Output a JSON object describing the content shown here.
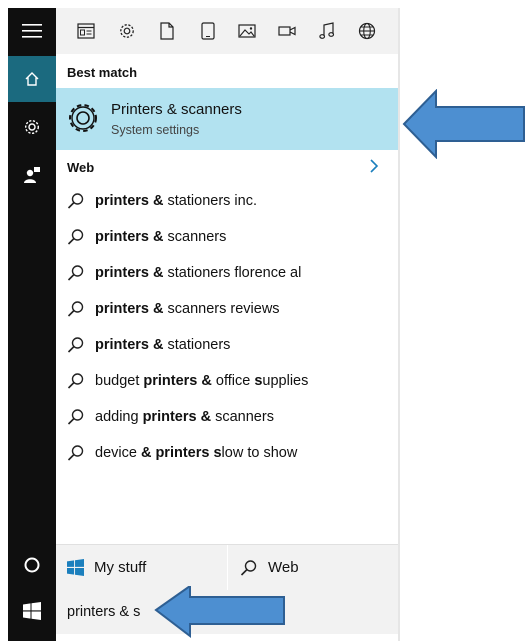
{
  "filters": [
    "apps",
    "settings",
    "documents",
    "tablet",
    "photos",
    "videos",
    "music",
    "web"
  ],
  "best_match": {
    "label": "Best match",
    "title": "Printers & scanners",
    "subtitle": "System settings"
  },
  "web": {
    "label": "Web",
    "suggestions": [
      {
        "parts": [
          {
            "t": "printers &",
            "b": true
          },
          {
            "t": " s",
            "b": false
          },
          {
            "t": "tationers inc.",
            "b": false
          }
        ]
      },
      {
        "parts": [
          {
            "t": "printers &",
            "b": true
          },
          {
            "t": " s",
            "b": false
          },
          {
            "t": "canners",
            "b": false
          }
        ]
      },
      {
        "parts": [
          {
            "t": "printers &",
            "b": true
          },
          {
            "t": " s",
            "b": false
          },
          {
            "t": "tationers florence al",
            "b": false
          }
        ]
      },
      {
        "parts": [
          {
            "t": "printers &",
            "b": true
          },
          {
            "t": " s",
            "b": false
          },
          {
            "t": "canners reviews",
            "b": false
          }
        ]
      },
      {
        "parts": [
          {
            "t": "printers &",
            "b": true
          },
          {
            "t": " s",
            "b": false
          },
          {
            "t": "tationers",
            "b": false
          }
        ]
      },
      {
        "parts": [
          {
            "t": "budget ",
            "b": false
          },
          {
            "t": "printers &",
            "b": true
          },
          {
            "t": " office ",
            "b": false
          },
          {
            "t": "s",
            "b": true
          },
          {
            "t": "upplies",
            "b": false
          }
        ]
      },
      {
        "parts": [
          {
            "t": "adding ",
            "b": false
          },
          {
            "t": "printers &",
            "b": true
          },
          {
            "t": " s",
            "b": false
          },
          {
            "t": "canners",
            "b": false
          }
        ]
      },
      {
        "parts": [
          {
            "t": "device ",
            "b": false
          },
          {
            "t": "& printers s",
            "b": true
          },
          {
            "t": "low to show",
            "b": false
          }
        ]
      }
    ]
  },
  "bottom": {
    "my_stuff": "My stuff",
    "web": "Web"
  },
  "search": {
    "query": "printers & s"
  },
  "colors": {
    "accent": "#1b6a7f",
    "highlight": "#b2e2f0",
    "annotation_arrow": "#4d8fd1"
  }
}
